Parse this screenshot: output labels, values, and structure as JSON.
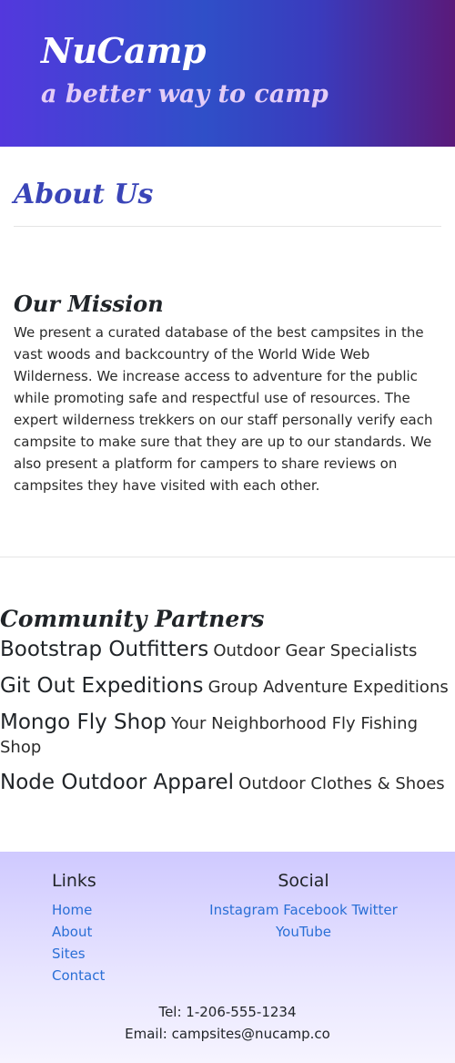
{
  "header": {
    "brand": "NuCamp",
    "tagline": "a better way to camp"
  },
  "about": {
    "title": "About Us",
    "mission_title": "Our Mission",
    "mission_text": "We present a curated database of the best campsites in the vast woods and backcountry of the World Wide Web Wilderness. We increase access to adventure for the public while promoting safe and respectful use of resources. The expert wilderness trekkers on our staff personally verify each campsite to make sure that they are up to our standards. We also present a platform for campers to share reviews on campsites they have visited with each other."
  },
  "partners": {
    "title": "Community Partners",
    "items": [
      {
        "name": "Bootstrap Outfitters",
        "desc": "Outdoor Gear Specialists"
      },
      {
        "name": "Git Out Expeditions",
        "desc": "Group Adventure Expeditions"
      },
      {
        "name": "Mongo Fly Shop",
        "desc": "Your Neighborhood Fly Fishing Shop"
      },
      {
        "name": "Node Outdoor Apparel",
        "desc": "Outdoor Clothes & Shoes"
      }
    ]
  },
  "footer": {
    "links_heading": "Links",
    "links": [
      "Home",
      "About",
      "Sites",
      "Contact"
    ],
    "social_heading": "Social",
    "social": [
      "Instagram",
      "Facebook",
      "Twitter",
      "YouTube"
    ],
    "tel": "Tel: 1-206-555-1234",
    "email": "Email: campsites@nucamp.co"
  }
}
